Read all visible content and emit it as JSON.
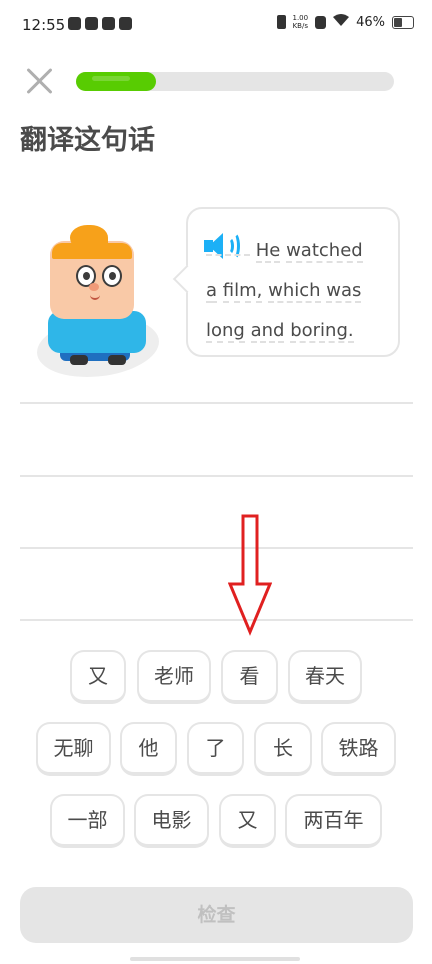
{
  "status_bar": {
    "time": "12:55",
    "net_speed_value": "1.00",
    "net_speed_unit": "KB/s",
    "battery": "46%"
  },
  "lesson": {
    "progress": 0.25,
    "prompt_title": "翻译这句话",
    "sentence_words": [
      "He",
      "watched",
      "a",
      "film,",
      "which",
      "was",
      "long",
      "and",
      "boring."
    ]
  },
  "word_bank": [
    "又",
    "老师",
    "看",
    "春天",
    "无聊",
    "他",
    "了",
    "长",
    "铁路",
    "一部",
    "电影",
    "又",
    "两百年"
  ],
  "check_button_label": "检查",
  "colors": {
    "progress_fill": "#58cc02",
    "speaker": "#1cb0f6",
    "arrow": "#e02020",
    "disabled_button": "#e5e5e5"
  },
  "icons": [
    "close-icon",
    "speaker-icon",
    "wifi-icon",
    "battery-icon",
    "arrow-down-icon"
  ]
}
